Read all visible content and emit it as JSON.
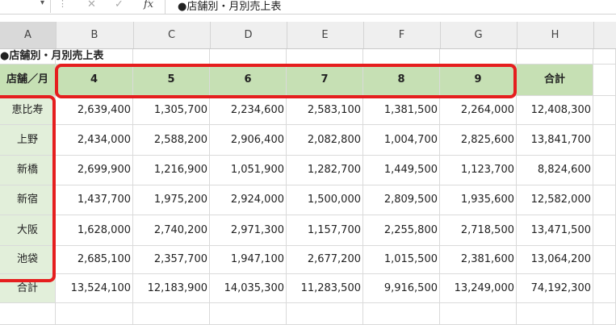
{
  "formula_bar": {
    "name_box_value": "",
    "cancel_icon": "close-icon",
    "enter_icon": "check-icon",
    "fx_label": "fx",
    "content": "●店舗別・月別売上表"
  },
  "column_headers": [
    "A",
    "B",
    "C",
    "D",
    "E",
    "F",
    "G",
    "H"
  ],
  "sheet": {
    "title": "●店舗別・月別売上表",
    "header_label": "店舗／月",
    "months": [
      "4",
      "5",
      "6",
      "7",
      "8",
      "9"
    ],
    "total_label": "合計",
    "rows": [
      {
        "store": "恵比寿",
        "values": [
          "2,639,400",
          "1,305,700",
          "2,234,600",
          "2,583,100",
          "1,381,500",
          "2,264,000"
        ],
        "total": "12,408,300"
      },
      {
        "store": "上野",
        "values": [
          "2,434,000",
          "2,588,200",
          "2,906,400",
          "2,082,800",
          "1,004,700",
          "2,825,600"
        ],
        "total": "13,841,700"
      },
      {
        "store": "新橋",
        "values": [
          "2,699,900",
          "1,216,900",
          "1,051,900",
          "1,282,700",
          "1,449,500",
          "1,123,700"
        ],
        "total": "8,824,600"
      },
      {
        "store": "新宿",
        "values": [
          "1,437,700",
          "1,975,200",
          "2,924,000",
          "1,500,000",
          "2,809,500",
          "1,935,600"
        ],
        "total": "12,582,000"
      },
      {
        "store": "大阪",
        "values": [
          "1,628,000",
          "2,740,200",
          "2,971,300",
          "1,157,700",
          "2,255,800",
          "2,718,500"
        ],
        "total": "13,471,500"
      },
      {
        "store": "池袋",
        "values": [
          "2,685,100",
          "2,357,700",
          "1,947,100",
          "2,677,200",
          "1,015,500",
          "2,381,600"
        ],
        "total": "13,064,200"
      }
    ],
    "totals_row": {
      "label": "合計",
      "values": [
        "13,524,100",
        "12,183,900",
        "14,035,300",
        "11,283,500",
        "9,916,500",
        "13,249,000"
      ],
      "total": "74,192,300"
    }
  },
  "colors": {
    "header_fill": "#c6e0b4",
    "label_fill": "#e2efda",
    "highlight": "#e51e1e"
  }
}
